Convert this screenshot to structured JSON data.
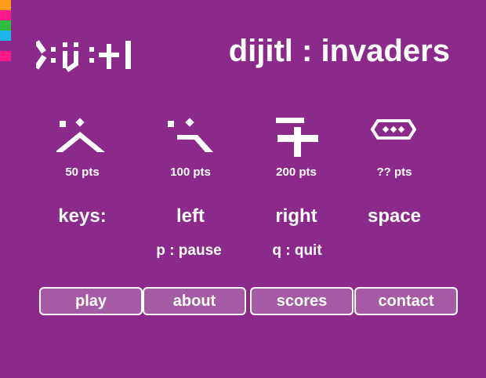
{
  "brand": {
    "logo_text": "dijitl",
    "swatch_colors": [
      "#ff9b1a",
      "#ff1a8c",
      "#2ebd3c",
      "#1fb5e8",
      "#8b2a8b",
      "#ff1a8c"
    ]
  },
  "header": {
    "title": "dijitl : invaders"
  },
  "invaders": [
    {
      "icon": "invader-caret-icon",
      "points": "50 pts"
    },
    {
      "icon": "invader-hook-icon",
      "points": "100 pts"
    },
    {
      "icon": "invader-plus-icon",
      "points": "200 pts"
    },
    {
      "icon": "invader-ufo-icon",
      "points": "?? pts"
    }
  ],
  "controls": {
    "keys_label": "keys:",
    "left": "left",
    "right": "right",
    "space": "space",
    "pause": "p : pause",
    "quit": "q : quit"
  },
  "menu": {
    "play": "play",
    "about": "about",
    "scores": "scores",
    "contact": "contact"
  },
  "colors": {
    "background": "#8b2a8b",
    "button_fill": "#a45aa4",
    "foreground": "#ffffff"
  }
}
